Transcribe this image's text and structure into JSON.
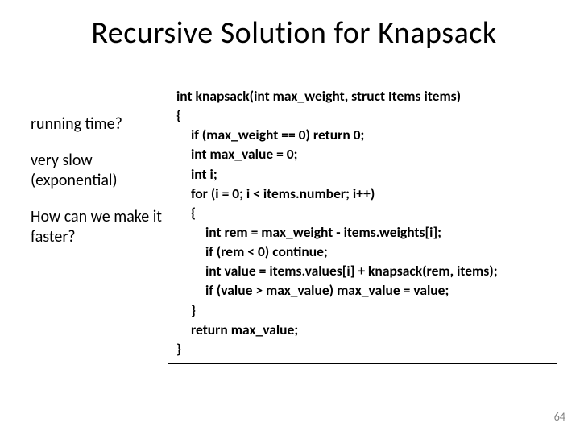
{
  "title": "Recursive Solution for Knapsack",
  "left": {
    "p1": "running time?",
    "p2": "very slow (exponential)",
    "p3": "How can we make it faster?"
  },
  "code": {
    "l01": "int knapsack(int max_weight, struct Items items)",
    "l02": "{",
    "l03": "if (max_weight == 0) return 0;",
    "l04": "int max_value = 0;",
    "l05": "int i;",
    "l06": "for (i = 0; i < items.number; i++)",
    "l07": "{",
    "l08": "int rem = max_weight - items.weights[i];",
    "l09": "if (rem < 0) continue;",
    "l10": "int value = items.values[i] + knapsack(rem, items);",
    "l11": "if (value > max_value) max_value = value;",
    "l12": "}",
    "l13": "return max_value;",
    "l14": "}"
  },
  "page_number": "64"
}
